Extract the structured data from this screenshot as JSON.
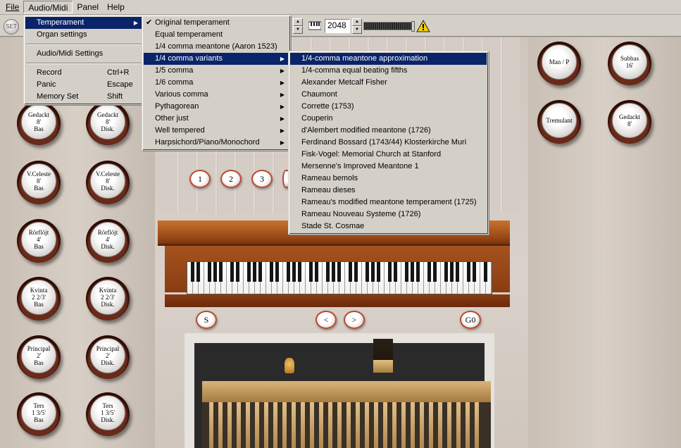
{
  "menubar": {
    "items": [
      "File",
      "Audio/Midi",
      "Panel",
      "Help"
    ]
  },
  "toolbar": {
    "set_label": "SET",
    "value": "2048"
  },
  "audio_midi_menu": {
    "items": [
      {
        "label": "Temperament",
        "shortcut": "",
        "submenu": true
      },
      {
        "label": "Organ settings",
        "shortcut": "",
        "submenu": false
      },
      {
        "label": "Audio/Midi Settings",
        "shortcut": "",
        "submenu": false
      },
      {
        "label": "Record",
        "shortcut": "Ctrl+R",
        "submenu": false
      },
      {
        "label": "Panic",
        "shortcut": "Escape",
        "submenu": false
      },
      {
        "label": "Memory Set",
        "shortcut": "Shift",
        "submenu": false
      }
    ]
  },
  "temperament_menu": {
    "items": [
      {
        "label": "Original temperament",
        "checked": true,
        "submenu": false
      },
      {
        "label": "Equal temperament",
        "checked": false,
        "submenu": false
      },
      {
        "label": "1/4 comma meantone (Aaron 1523)",
        "checked": false,
        "submenu": false
      },
      {
        "label": "1/4 comma variants",
        "checked": false,
        "submenu": true
      },
      {
        "label": "1/5 comma",
        "checked": false,
        "submenu": true
      },
      {
        "label": "1/6 comma",
        "checked": false,
        "submenu": true
      },
      {
        "label": "Various comma",
        "checked": false,
        "submenu": true
      },
      {
        "label": "Pythagorean",
        "checked": false,
        "submenu": true
      },
      {
        "label": "Other just",
        "checked": false,
        "submenu": true
      },
      {
        "label": "Well tempered",
        "checked": false,
        "submenu": true
      },
      {
        "label": "Harpsichord/Piano/Monochord",
        "checked": false,
        "submenu": true
      }
    ]
  },
  "variants_menu": {
    "items": [
      "1/4-comma meantone approximation",
      "1/4-comma equal beating fifths",
      "Alexander Metcalf Fisher",
      "Chaumont",
      "Corrette (1753)",
      "Couperin",
      "d'Alembert modified meantone (1726)",
      "Ferdinand Bossard (1743/44) Klosterkirche Muri",
      "Fisk-Vogel: Memorial Church at Stanford",
      "Mersenne's Improved Meantone 1",
      "Rameau bemols",
      "Rameau dieses",
      "Rameau's modified meantone temperament (1725)",
      "Rameau Nouveau Systeme (1726)",
      "Stade St. Cosmae"
    ]
  },
  "stops_left": [
    {
      "l1": "Gedackt",
      "l2": "8'",
      "l3": "Bas"
    },
    {
      "l1": "Gedackt",
      "l2": "8'",
      "l3": "Disk."
    },
    {
      "l1": "V.Celeste",
      "l2": "8'",
      "l3": "Bas"
    },
    {
      "l1": "V.Celeste",
      "l2": "8'",
      "l3": "Disk."
    },
    {
      "l1": "Rörflöjt",
      "l2": "4'",
      "l3": "Bas"
    },
    {
      "l1": "Rörflöjt",
      "l2": "4'",
      "l3": "Disk."
    },
    {
      "l1": "Kvinta",
      "l2": "2 2/3'",
      "l3": "Bas"
    },
    {
      "l1": "Kvinta",
      "l2": "2 2/3'",
      "l3": "Disk."
    },
    {
      "l1": "Principal",
      "l2": "2'",
      "l3": "Bas"
    },
    {
      "l1": "Principal",
      "l2": "2'",
      "l3": "Disk."
    },
    {
      "l1": "Ters",
      "l2": "1 3/5'",
      "l3": "Bas"
    },
    {
      "l1": "Ters",
      "l2": "1 3/5'",
      "l3": "Disk."
    }
  ],
  "stops_right": [
    {
      "l1": "Man / P",
      "l2": "",
      "l3": ""
    },
    {
      "l1": "Subbas",
      "l2": "16'",
      "l3": ""
    },
    {
      "l1": "Tremulant",
      "l2": "",
      "l3": ""
    },
    {
      "l1": "Gedackt",
      "l2": "8'",
      "l3": ""
    }
  ],
  "combination_buttons": [
    "1",
    "2",
    "3"
  ],
  "lower_buttons": {
    "set": "S",
    "prev": "<",
    "next": ">",
    "go": "G0"
  }
}
